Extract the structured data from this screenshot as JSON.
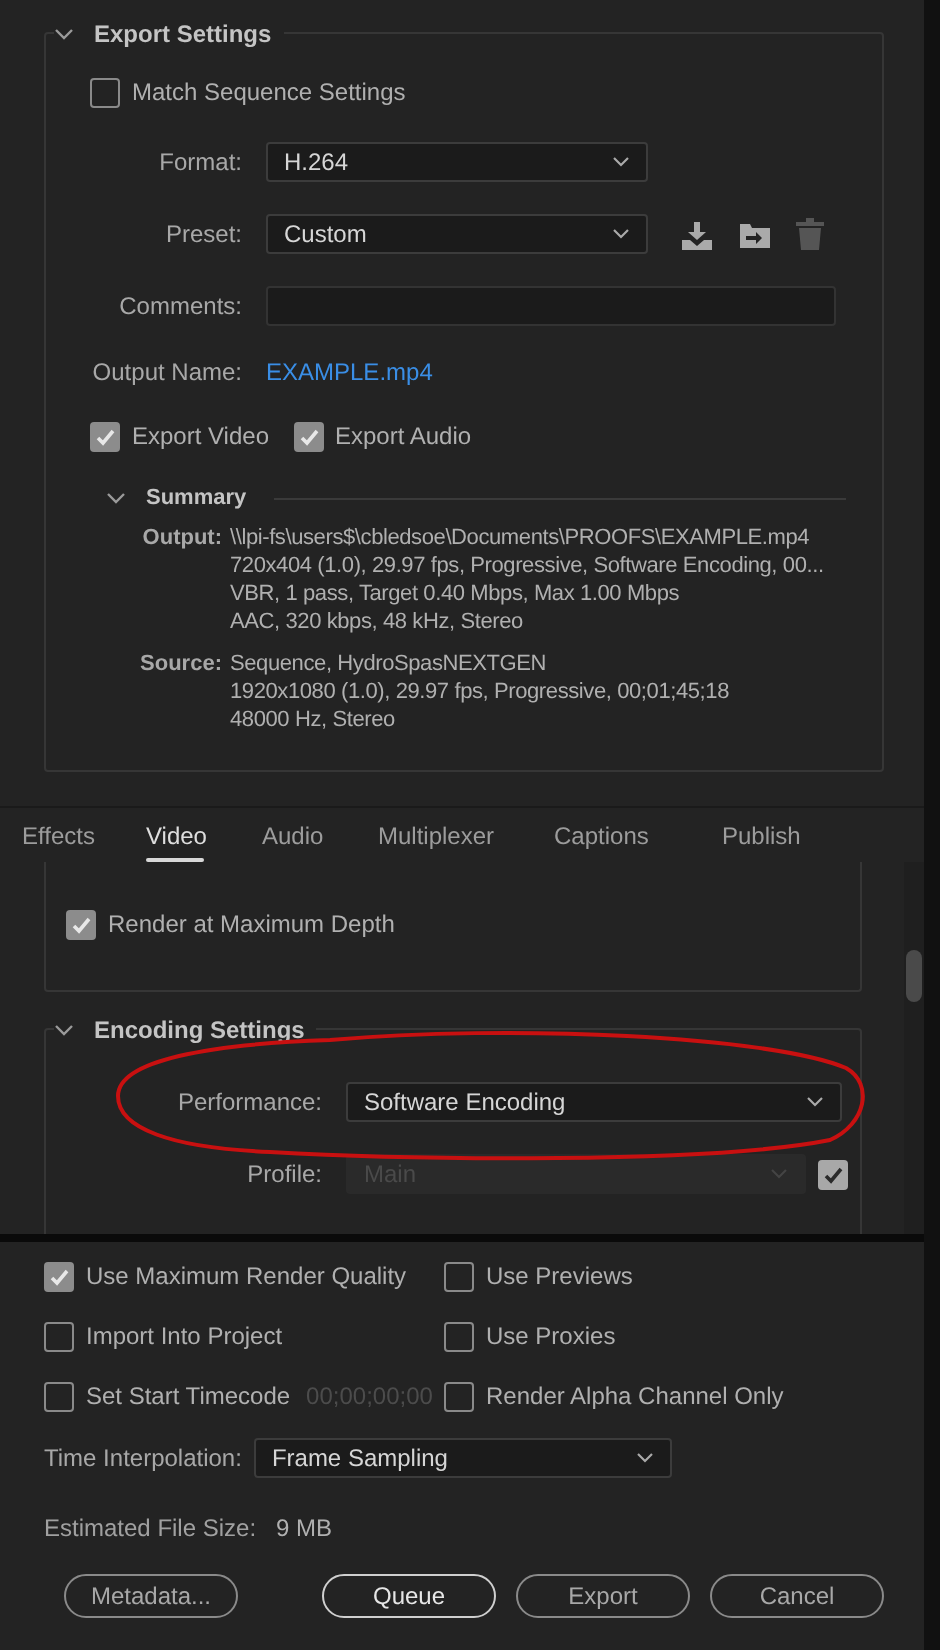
{
  "export_settings": {
    "title": "Export Settings",
    "expanded": true,
    "match_sequence": {
      "label": "Match Sequence Settings",
      "checked": false
    },
    "format": {
      "label": "Format:",
      "value": "H.264"
    },
    "preset": {
      "label": "Preset:",
      "value": "Custom"
    },
    "comments": {
      "label": "Comments:"
    },
    "output_name": {
      "label": "Output Name:",
      "value": "EXAMPLE.mp4"
    },
    "exports": [
      {
        "label": "Export Video",
        "checked": true
      },
      {
        "label": "Export Audio",
        "checked": true
      }
    ],
    "summary": {
      "title": "Summary",
      "expanded": true,
      "groups": [
        {
          "label": "Output:",
          "lines": [
            "\\\\lpi-fs\\users$\\cbledsoe\\Documents\\PROOFS\\EXAMPLE.mp4",
            "720x404 (1.0), 29.97 fps, Progressive, Software Encoding, 00...",
            "VBR, 1 pass, Target 0.40 Mbps, Max 1.00 Mbps",
            "AAC, 320 kbps, 48 kHz, Stereo"
          ]
        },
        {
          "label": "Source:",
          "lines": [
            "Sequence, HydroSpasNEXTGEN",
            "1920x1080 (1.0), 29.97 fps, Progressive, 00;01;45;18",
            "48000 Hz, Stereo"
          ]
        }
      ]
    }
  },
  "tabs": [
    {
      "label": "Effects",
      "selected": false
    },
    {
      "label": "Video",
      "selected": true
    },
    {
      "label": "Audio",
      "selected": false
    },
    {
      "label": "Multiplexer",
      "selected": false
    },
    {
      "label": "Captions",
      "selected": false
    },
    {
      "label": "Publish",
      "selected": false
    }
  ],
  "video_panel": {
    "render_max_depth": {
      "label": "Render at Maximum Depth",
      "checked": true
    },
    "encoding": {
      "title": "Encoding Settings",
      "expanded": true,
      "performance": {
        "label": "Performance:",
        "value": "Software Encoding"
      },
      "profile": {
        "label": "Profile:",
        "value": "Main",
        "disabled": true,
        "checked": true
      }
    }
  },
  "annotations": [
    {
      "kind": "ellipse"
    }
  ],
  "options": [
    {
      "label": "Use Maximum Render Quality",
      "checked": true
    },
    {
      "label": "Use Previews",
      "checked": false
    },
    {
      "label": "Import Into Project",
      "checked": false
    },
    {
      "label": "Use Proxies",
      "checked": false
    },
    {
      "label": "Set Start Timecode",
      "checked": false,
      "value": "00;00;00;00"
    },
    {
      "label": "Render Alpha Channel Only",
      "checked": false
    }
  ],
  "time_interpolation": {
    "label": "Time Interpolation:",
    "value": "Frame Sampling"
  },
  "file_size": {
    "label": "Estimated File Size:",
    "value": "9 MB"
  },
  "buttons": [
    {
      "label": "Metadata...",
      "primary": false
    },
    {
      "label": "Queue",
      "primary": true
    },
    {
      "label": "Export",
      "primary": false
    },
    {
      "label": "Cancel",
      "primary": false
    }
  ]
}
